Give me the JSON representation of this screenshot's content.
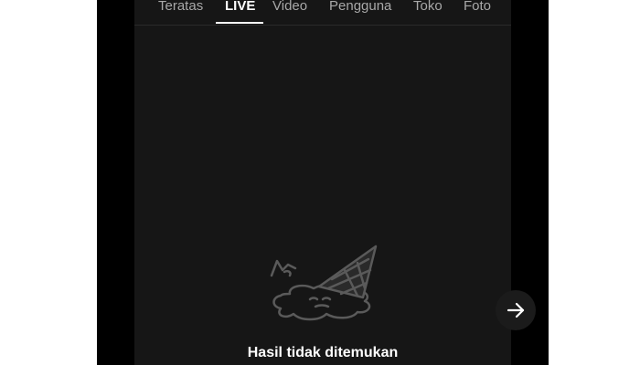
{
  "tabs": {
    "items": [
      {
        "label": "Teratas"
      },
      {
        "label": "LIVE"
      },
      {
        "label": "Video"
      },
      {
        "label": "Pengguna"
      },
      {
        "label": "Toko"
      },
      {
        "label": "Foto"
      }
    ],
    "active": "LIVE"
  },
  "empty_state": {
    "message": "Hasil tidak ditemukan",
    "illustration": "melted-ice-cream-icon"
  },
  "navigation": {
    "next_icon": "arrow-right-icon"
  },
  "colors": {
    "phone_frame": "#000000",
    "screen_background": "#161616",
    "active_tab_text": "#ffffff",
    "inactive_tab_text": "#a8a8a8",
    "illustration_stroke": "#5a5a5a",
    "next_button_background": "#1b1b1b"
  }
}
